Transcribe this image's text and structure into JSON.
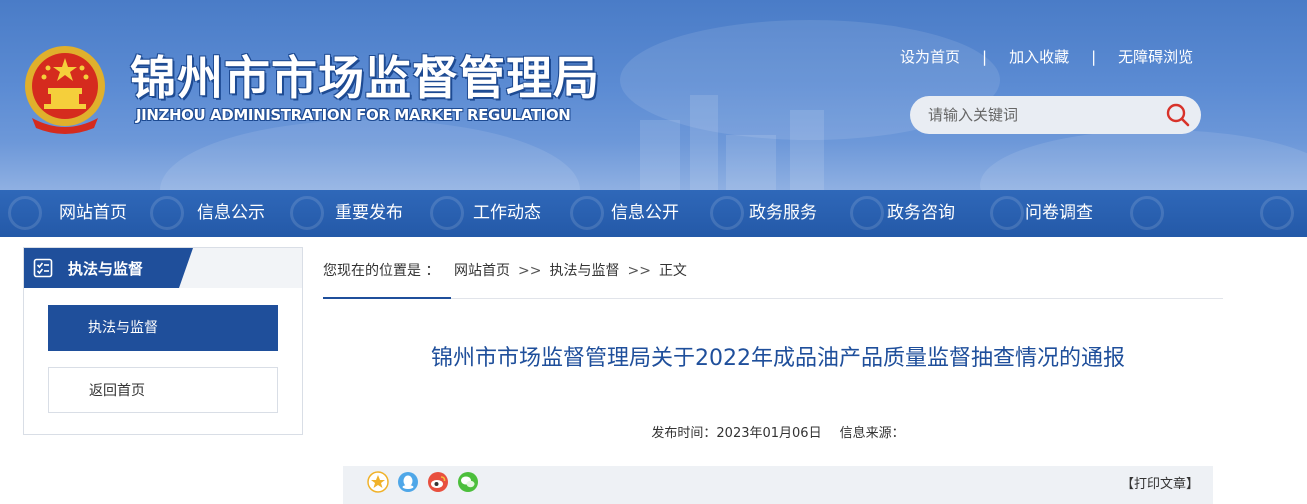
{
  "header": {
    "title": "锦州市市场监督管理局",
    "subtitle": "JINZHOU ADMINISTRATION FOR MARKET REGULATION",
    "top_links": [
      "设为首页",
      "加入收藏",
      "无障碍浏览"
    ],
    "separator": "|",
    "search_placeholder": "请输入关键词"
  },
  "nav": {
    "items": [
      "网站首页",
      "信息公示",
      "重要发布",
      "工作动态",
      "信息公开",
      "政务服务",
      "政务咨询",
      "问卷调查"
    ]
  },
  "sidebar": {
    "heading": "执法与监督",
    "items": [
      {
        "label": "执法与监督",
        "active": true
      },
      {
        "label": "返回首页",
        "active": false
      }
    ]
  },
  "breadcrumb": {
    "prefix": "您现在的位置是 ：",
    "items": [
      "网站首页",
      "执法与监督",
      "正文"
    ],
    "arrow": ">>"
  },
  "article": {
    "title": "锦州市市场监督管理局关于2022年成品油产品质量监督抽查情况的通报",
    "publish_label": "发布时间：",
    "publish_date": "2023年01月06日",
    "source_label": "信息来源："
  },
  "share": {
    "icons": [
      "qzone-icon",
      "qq-icon",
      "weibo-icon",
      "wechat-icon"
    ],
    "print_label": "【打印文章】"
  },
  "colors": {
    "header_blue": "#4a7cc7",
    "nav_blue": "#2459a8",
    "accent": "#1f4f9b",
    "title_blue": "#1f4f9b"
  }
}
